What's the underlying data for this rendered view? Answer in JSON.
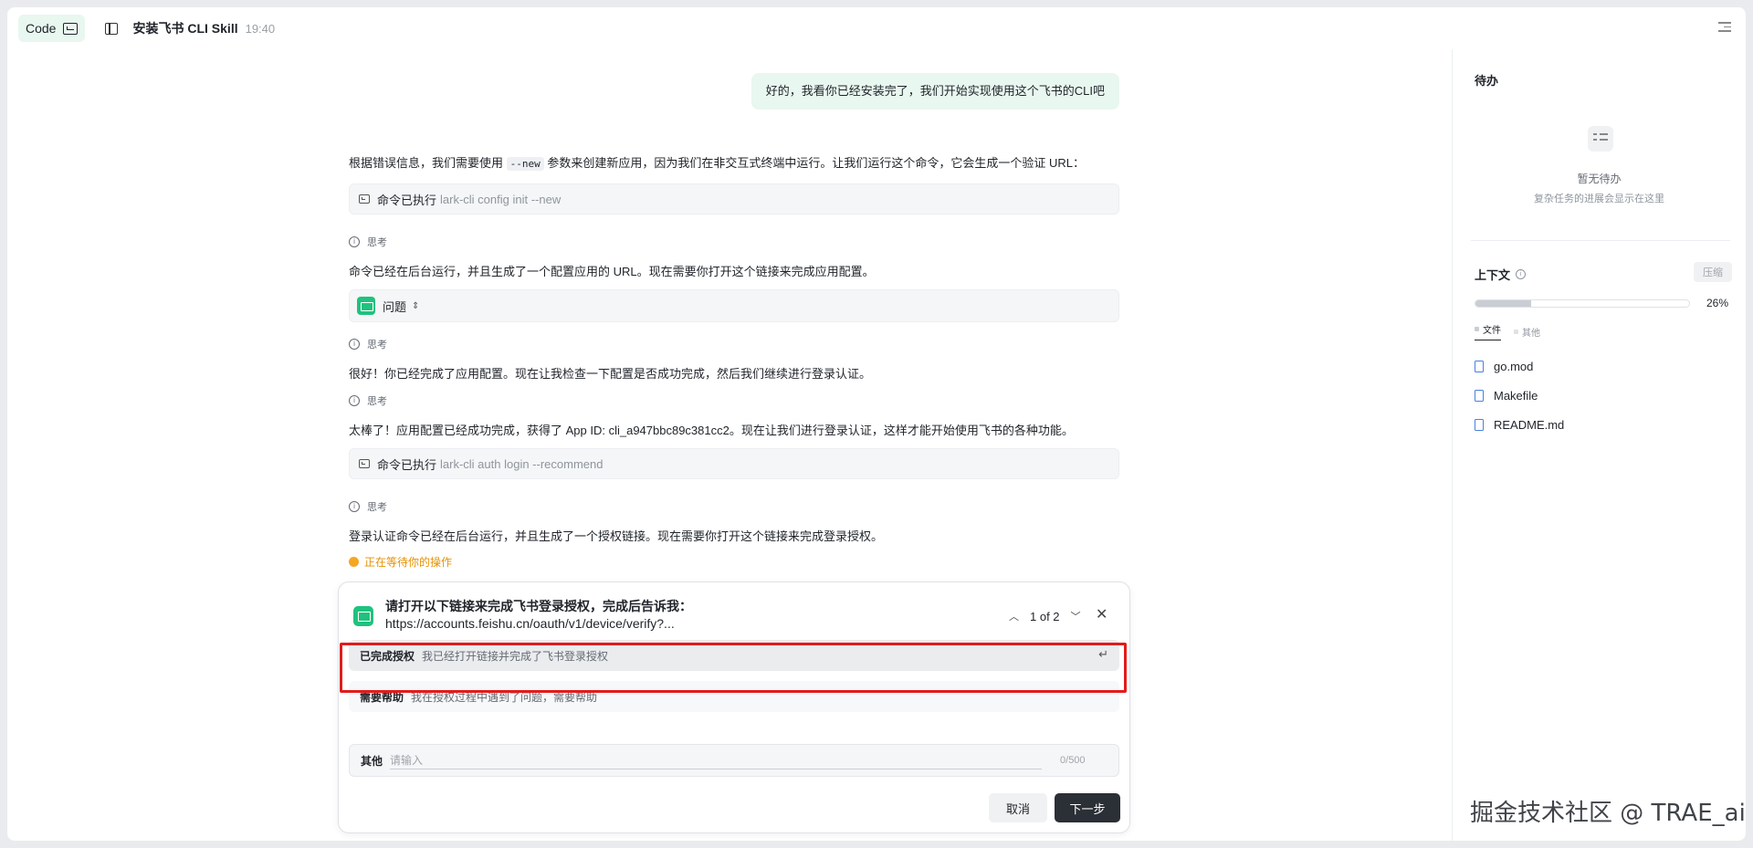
{
  "header": {
    "mode_label": "Code",
    "session_title": "安装飞书 CLI Skill",
    "session_time": "19:40"
  },
  "chat": {
    "user_message": "好的，我看你已经安装完了，我们开始实现使用这个飞书的CLI吧",
    "para1_before": "根据错误信息，我们需要使用 ",
    "para1_code": "--new",
    "para1_after": " 参数来创建新应用，因为我们在非交互式终端中运行。让我们运行这个命令，它会生成一个验证 URL：",
    "cmd1_label": "命令已执行",
    "cmd1_text": "lark-cli config init --new",
    "think_label": "思考",
    "para2": "命令已经在后台运行，并且生成了一个配置应用的 URL。现在需要你打开这个链接来完成应用配置。",
    "question_label": "问题",
    "para3": "很好！你已经完成了应用配置。现在让我检查一下配置是否成功完成，然后我们继续进行登录认证。",
    "para4": "太棒了！应用配置已经成功完成，获得了 App ID: cli_a947bbc89c381cc2。现在让我们进行登录认证，这样才能开始使用飞书的各种功能。",
    "cmd2_label": "命令已执行",
    "cmd2_text": "lark-cli auth login --recommend",
    "para5": "登录认证命令已经在后台运行，并且生成了一个授权链接。现在需要你打开这个链接来完成登录授权。",
    "waiting": "正在等待你的操作"
  },
  "dialog": {
    "title": "请打开以下链接来完成飞书登录授权，完成后告诉我：",
    "url": "https://accounts.feishu.cn/oauth/v1/device/verify?...",
    "pager": "1 of 2",
    "options": [
      {
        "label": "已完成授权",
        "desc": "我已经打开链接并完成了飞书登录授权"
      },
      {
        "label": "需要帮助",
        "desc": "我在授权过程中遇到了问题，需要帮助"
      }
    ],
    "other_label": "其他",
    "other_placeholder": "请输入",
    "other_counter": "0/500",
    "cancel_label": "取消",
    "next_label": "下一步"
  },
  "right_panel": {
    "todo_title": "待办",
    "todo_empty_title": "暂无待办",
    "todo_empty_sub": "复杂任务的进展会显示在这里",
    "context_title": "上下文",
    "compress_label": "压缩",
    "context_percent_label": "26%",
    "context_fraction": 0.26,
    "legend_files": "文件",
    "legend_other": "其他",
    "files": [
      "go.mod",
      "Makefile",
      "README.md"
    ]
  },
  "watermark": "掘金技术社区 @ TRAE_ai",
  "colors": {
    "accent_green": "#1fc27e",
    "pill_bg": "#e8f7ef",
    "waiting": "#e69100",
    "highlight_red": "#e31b1b"
  }
}
